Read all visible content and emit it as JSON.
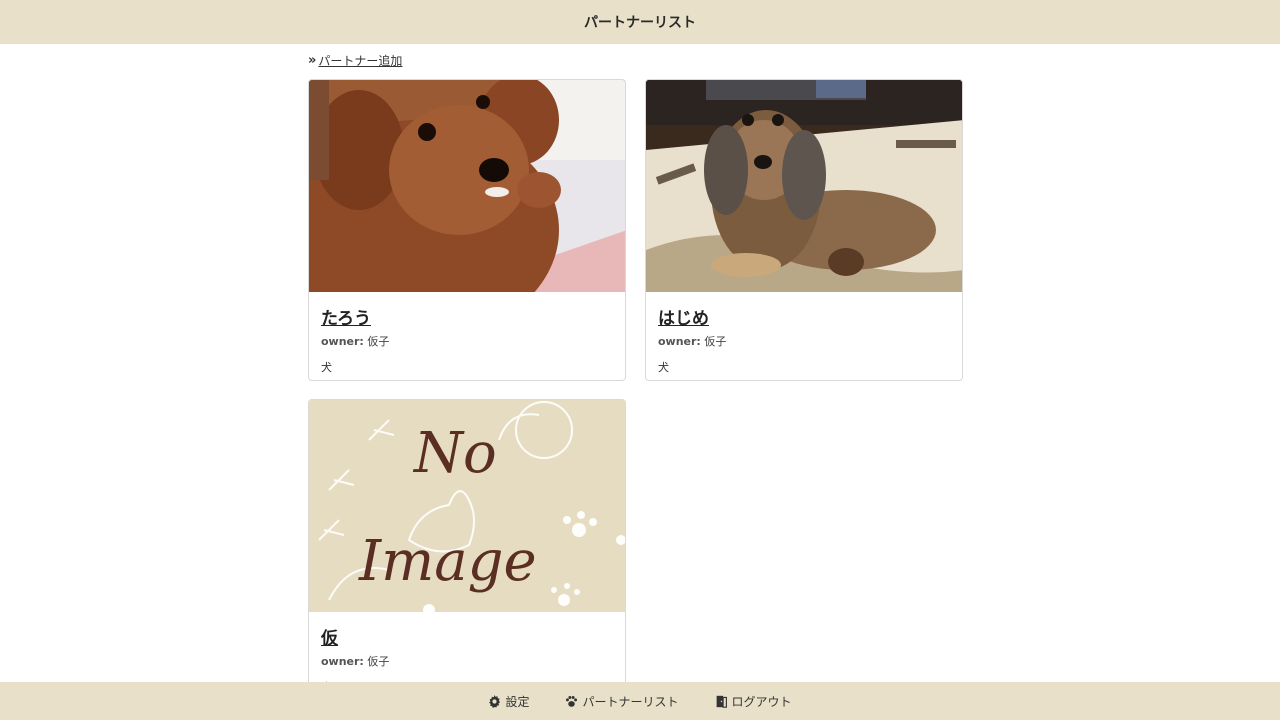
{
  "header": {
    "title": "パートナーリスト"
  },
  "actions": {
    "add_partner": "パートナー追加"
  },
  "partners": [
    {
      "name": "たろう",
      "owner_label": "owner:",
      "owner": "仮子",
      "type": "犬",
      "image": "brown-poodle-photo"
    },
    {
      "name": "はじめ",
      "owner_label": "owner:",
      "owner": "仮子",
      "type": "犬",
      "image": "dachshund-photo"
    },
    {
      "name": "仮",
      "owner_label": "owner:",
      "owner": "仮子",
      "type": "犬",
      "image": "no-image-placeholder",
      "placeholder_text": {
        "line1": "No",
        "line2": "Image"
      }
    }
  ],
  "footer": {
    "items": [
      {
        "label": "設定",
        "icon": "gear-icon"
      },
      {
        "label": "パートナーリスト",
        "icon": "paw-icon"
      },
      {
        "label": "ログアウト",
        "icon": "door-icon"
      }
    ]
  },
  "colors": {
    "bar_bg": "#e8e0c9",
    "placeholder_bg": "#e6dcc2",
    "placeholder_text": "#5a2e22"
  }
}
